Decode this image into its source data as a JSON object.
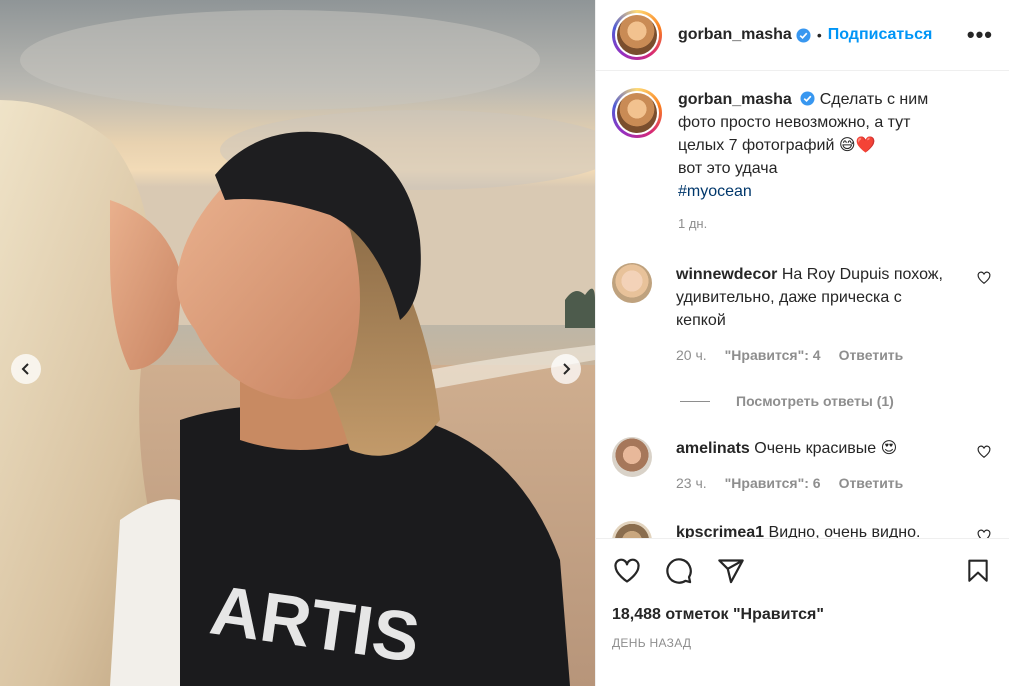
{
  "post": {
    "username": "gorban_masha",
    "separator": "•",
    "follow_label": "Подписаться",
    "more_label": "•••",
    "caption_lines": [
      "Сделать с ним",
      "фото просто невозможно, а тут",
      "целых 7 фотографий 😅❤️",
      "вот это удача"
    ],
    "hashtag": "#myocean",
    "caption_age": "1 дн.",
    "likes_text": "18,488 отметок \"Нравится\"",
    "timestamp": "ДЕНЬ НАЗАД"
  },
  "comments": [
    {
      "user": "winnewdecor",
      "text": "На Roy Dupuis похож, удивительно, даже прическа с кепкой",
      "age": "20 ч.",
      "likes": "\"Нравится\": 4",
      "reply_label": "Ответить",
      "view_replies": "Посмотреть ответы (1)"
    },
    {
      "user": "amelinats",
      "text": "Очень красивые 😍",
      "age": "23 ч.",
      "likes": "\"Нравится\": 6",
      "reply_label": "Ответить"
    },
    {
      "user": "kpscrimea1",
      "text": "Видно, очень видно."
    }
  ],
  "icons": {
    "verified": "verified-badge-icon",
    "like": "heart-icon",
    "comment": "comment-icon",
    "share": "share-icon",
    "save": "bookmark-icon",
    "prev": "chevron-left-icon",
    "next": "chevron-right-icon"
  },
  "colors": {
    "link_blue": "#0095f6",
    "hashtag": "#00376b",
    "muted": "#8e8e8e",
    "text": "#262626"
  }
}
